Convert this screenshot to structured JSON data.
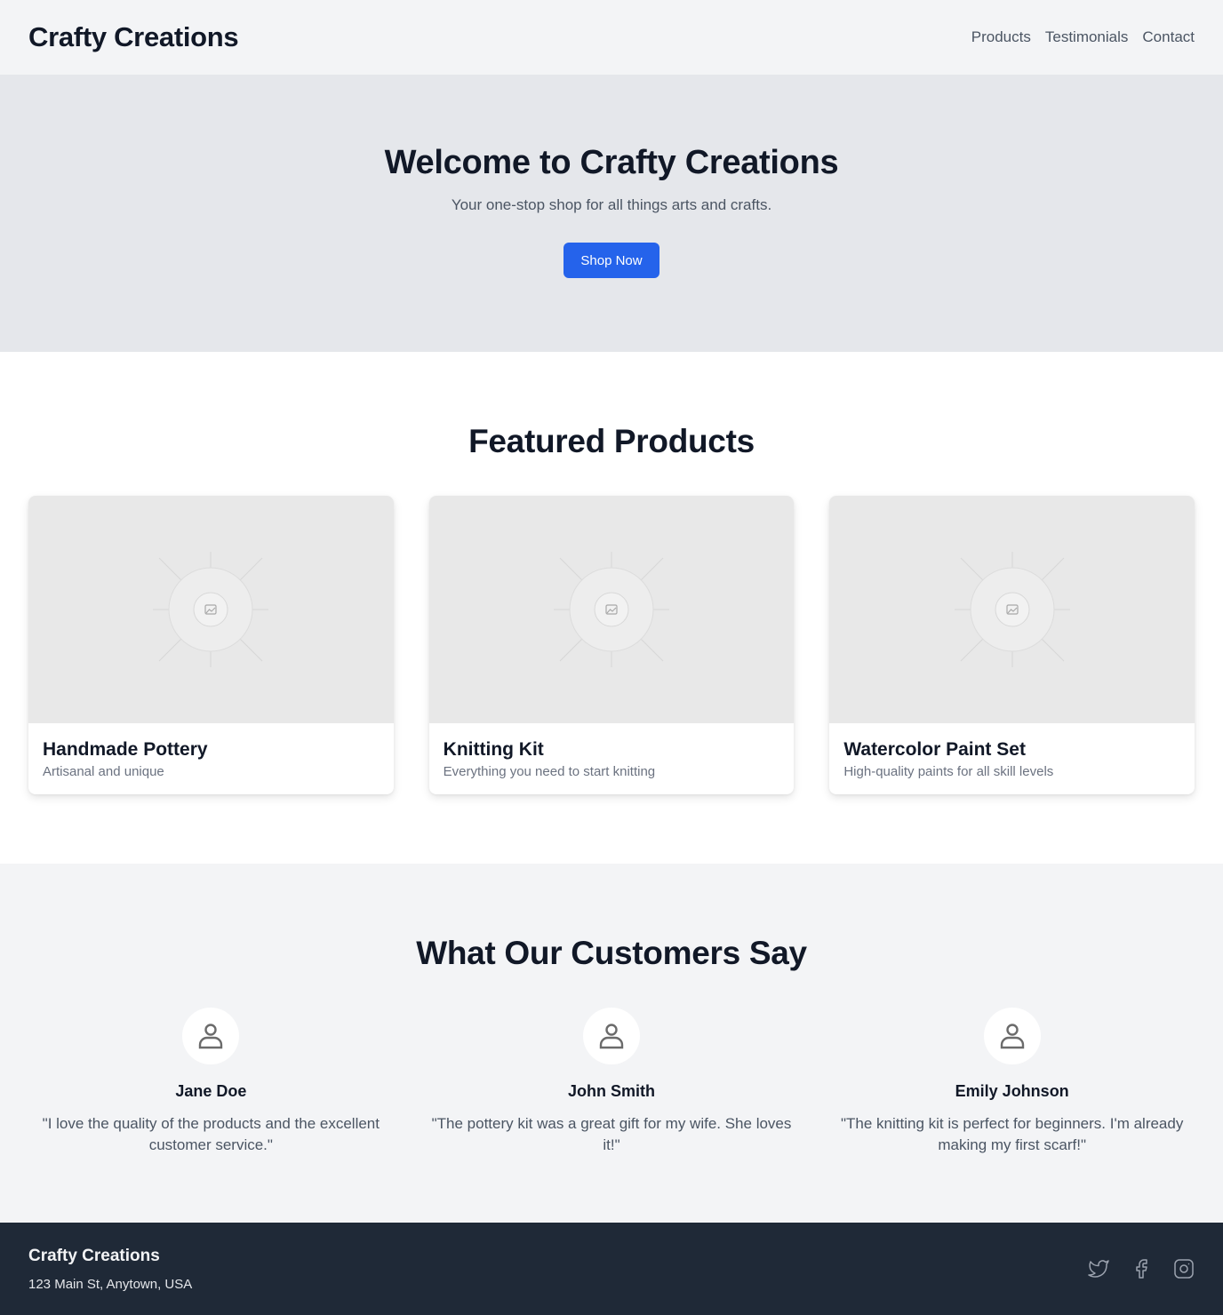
{
  "header": {
    "brand": "Crafty Creations",
    "nav": [
      "Products",
      "Testimonials",
      "Contact"
    ]
  },
  "hero": {
    "title": "Welcome to Crafty Creations",
    "subtitle": "Your one-stop shop for all things arts and crafts.",
    "cta_label": "Shop Now"
  },
  "featured": {
    "title": "Featured Products",
    "products": [
      {
        "name": "Handmade Pottery",
        "description": "Artisanal and unique",
        "image_icon": "image-placeholder-icon"
      },
      {
        "name": "Knitting Kit",
        "description": "Everything you need to start knitting",
        "image_icon": "image-placeholder-icon"
      },
      {
        "name": "Watercolor Paint Set",
        "description": "High-quality paints for all skill levels",
        "image_icon": "image-placeholder-icon"
      }
    ]
  },
  "testimonials": {
    "title": "What Our Customers Say",
    "items": [
      {
        "name": "Jane Doe",
        "quote": "\"I love the quality of the products and the excellent customer service.\"",
        "avatar_icon": "user-icon"
      },
      {
        "name": "John Smith",
        "quote": "\"The pottery kit was a great gift for my wife. She loves it!\"",
        "avatar_icon": "user-icon"
      },
      {
        "name": "Emily Johnson",
        "quote": "\"The knitting kit is perfect for beginners. I'm already making my first scarf!\"",
        "avatar_icon": "user-icon"
      }
    ]
  },
  "footer": {
    "brand": "Crafty Creations",
    "address": "123 Main St, Anytown, USA",
    "social_icons": [
      "twitter-icon",
      "facebook-icon",
      "instagram-icon"
    ]
  },
  "colors": {
    "accent": "#2563eb",
    "header_bg": "#f3f4f6",
    "hero_bg": "#e5e7eb",
    "footer_bg": "#1f2937"
  }
}
